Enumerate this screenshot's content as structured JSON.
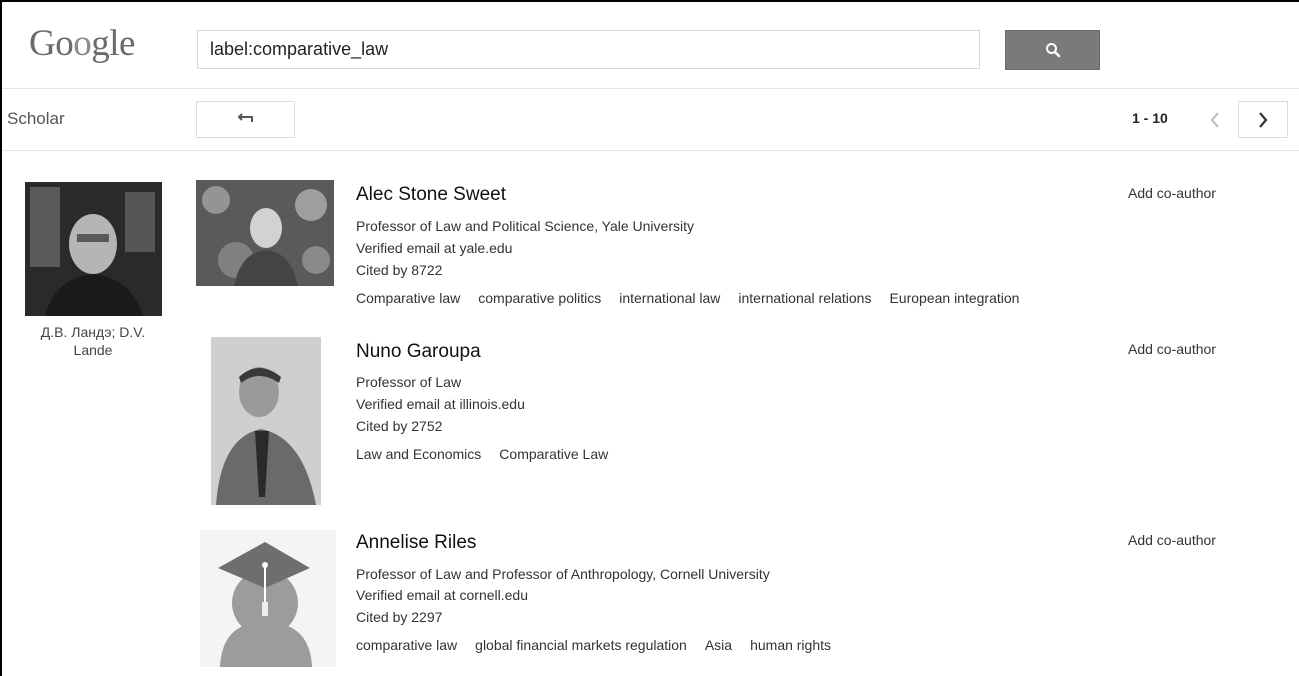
{
  "header": {
    "logo": "Google",
    "search_value": "label:comparative_law"
  },
  "subbar": {
    "scholar_label": "Scholar",
    "pager_text": "1 - 10"
  },
  "user": {
    "name_line1": "Д.В. Ландэ; D.V.",
    "name_line2": "Lande"
  },
  "results": [
    {
      "name": "Alec Stone Sweet",
      "affiliation": "Professor of Law and Political Science, Yale University",
      "email": "Verified email at yale.edu",
      "cited": "Cited by 8722",
      "tags": [
        "Comparative law",
        "comparative politics",
        "international law",
        "international relations",
        "European integration"
      ],
      "action": "Add co-author"
    },
    {
      "name": "Nuno Garoupa",
      "affiliation": "Professor of Law",
      "email": "Verified email at illinois.edu",
      "cited": "Cited by 2752",
      "tags": [
        "Law and Economics",
        "Comparative Law"
      ],
      "action": "Add co-author"
    },
    {
      "name": "Annelise Riles",
      "affiliation": "Professor of Law and Professor of Anthropology, Cornell University",
      "email": "Verified email at cornell.edu",
      "cited": "Cited by 2297",
      "tags": [
        "comparative law",
        "global financial markets regulation",
        "Asia",
        "human rights"
      ],
      "action": "Add co-author"
    }
  ],
  "icons": {
    "search": "search-icon",
    "back": "back-arrow-icon",
    "prev": "chevron-left-icon",
    "next": "chevron-right-icon"
  }
}
